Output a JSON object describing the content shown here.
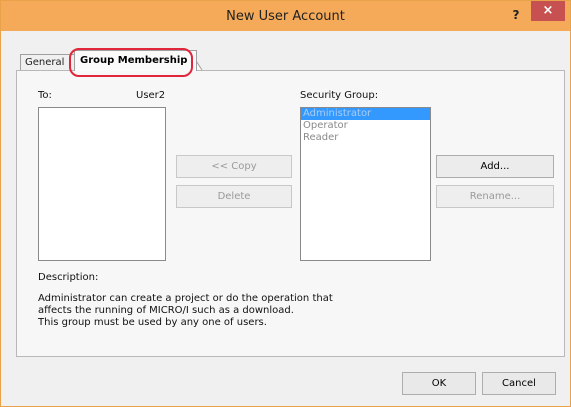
{
  "window": {
    "title": "New User Account",
    "help_label": "?",
    "close_label": "×"
  },
  "tabs": {
    "general": "General",
    "group_membership": "Group Membership"
  },
  "membership": {
    "to_label": "To:",
    "user_name": "User2",
    "security_group_label": "Security Group:",
    "groups": [
      {
        "label": "Administrator",
        "selected": true
      },
      {
        "label": "Operator",
        "selected": false
      },
      {
        "label": "Reader",
        "selected": false
      }
    ],
    "copy_label": "<< Copy",
    "delete_label": "Delete",
    "add_label": "Add...",
    "rename_label": "Rename..."
  },
  "description": {
    "heading": "Description:",
    "lines": [
      "Administrator can create a project or do the operation that",
      "affects the running of MICRO/I such as a download.",
      "This group must be used by any one of users."
    ]
  },
  "footer": {
    "ok_label": "OK",
    "cancel_label": "Cancel"
  },
  "colors": {
    "titlebar": "#f4aa58",
    "close": "#c75050",
    "highlight": "#e0263a",
    "selection": "#3399ff"
  }
}
